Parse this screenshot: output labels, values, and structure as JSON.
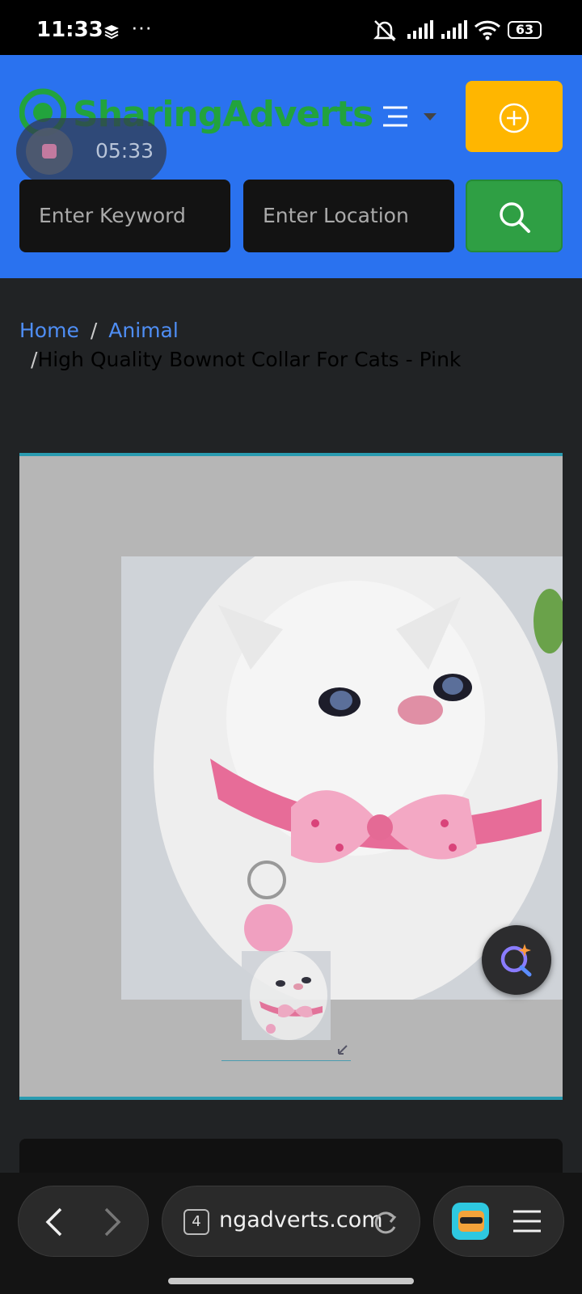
{
  "status_bar": {
    "time": "11:33",
    "battery": "63"
  },
  "header": {
    "logo_text": "SharingAdverts",
    "recording_time": "05:33",
    "keyword_placeholder": "Enter Keyword",
    "location_placeholder": "Enter Location"
  },
  "breadcrumb": {
    "home": "Home",
    "category": "Animal",
    "separator": "/",
    "current": "High Quality Bownot Collar For Cats - Pink"
  },
  "browser": {
    "tab_count": "4",
    "url": "ngadverts.com"
  },
  "colors": {
    "header_bg": "#2a72ef",
    "post_button": "#ffb600",
    "search_button": "#2f9f44",
    "link": "#4f8ef5"
  }
}
